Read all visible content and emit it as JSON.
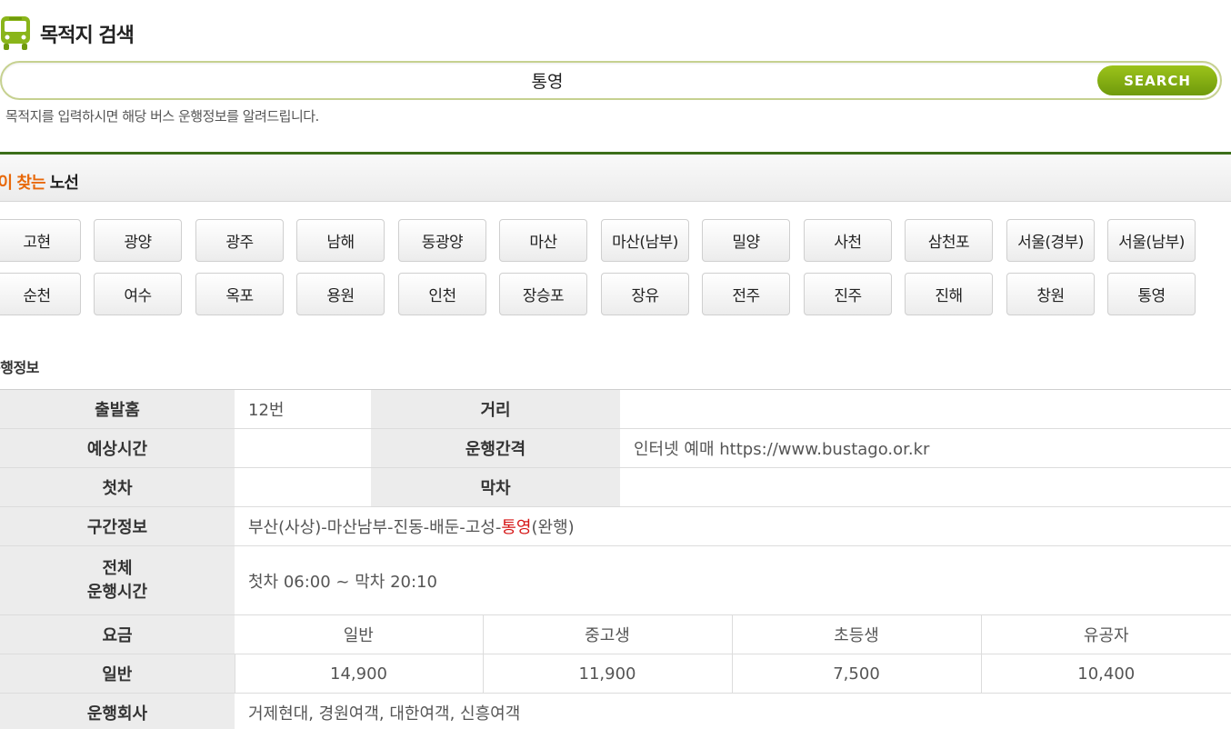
{
  "header": {
    "title": "목적지 검색",
    "icon": "bus-icon"
  },
  "search": {
    "value": "통영",
    "button_label": "SEARCH",
    "hint": "목적지를 입력하시면 해당 버스 운행정보를 알려드립니다."
  },
  "popular": {
    "title_highlight": "많이 찾는",
    "title_rest": " 노선",
    "routes": [
      "고현",
      "광양",
      "광주",
      "남해",
      "동광양",
      "마산",
      "마산(남부)",
      "밀양",
      "사천",
      "삼천포",
      "서울(경부)",
      "서울(남부)",
      "순천",
      "여수",
      "옥포",
      "용원",
      "인천",
      "장승포",
      "장유",
      "전주",
      "진주",
      "진해",
      "창원",
      "통영"
    ]
  },
  "info": {
    "section_label": "운행정보",
    "platform_label": "출발홈",
    "platform_value": "12번",
    "distance_label": "거리",
    "distance_value": "",
    "est_time_label": "예상시간",
    "est_time_value": "",
    "interval_label": "운행간격",
    "interval_value": "인터넷 예매 https://www.bustago.or.kr",
    "first_bus_label": "첫차",
    "first_bus_value": "",
    "last_bus_label": "막차",
    "last_bus_value": "",
    "section_info_label": "구간정보",
    "route_prefix": "부산(사상)-마산남부-진동-배둔-고성-",
    "route_dest": "통영",
    "route_suffix": "(완행)",
    "total_time_label_1": "전체",
    "total_time_label_2": "운행시간",
    "total_time_value": "첫차 06:00 ~ 막차 20:10",
    "fare_label": "요금",
    "fare_types": [
      "일반",
      "중고생",
      "초등생",
      "유공자"
    ],
    "fare_row_label": "일반",
    "fare_values": [
      "14,900",
      "11,900",
      "7,500",
      "10,400"
    ],
    "company_label": "운행회사",
    "company_value": "거제현대, 경원여객, 대한여객, 신흥여객"
  },
  "colors": {
    "accent_green": "#8ab51a",
    "popular_orange": "#e8690b",
    "destination_red": "#d61717"
  }
}
